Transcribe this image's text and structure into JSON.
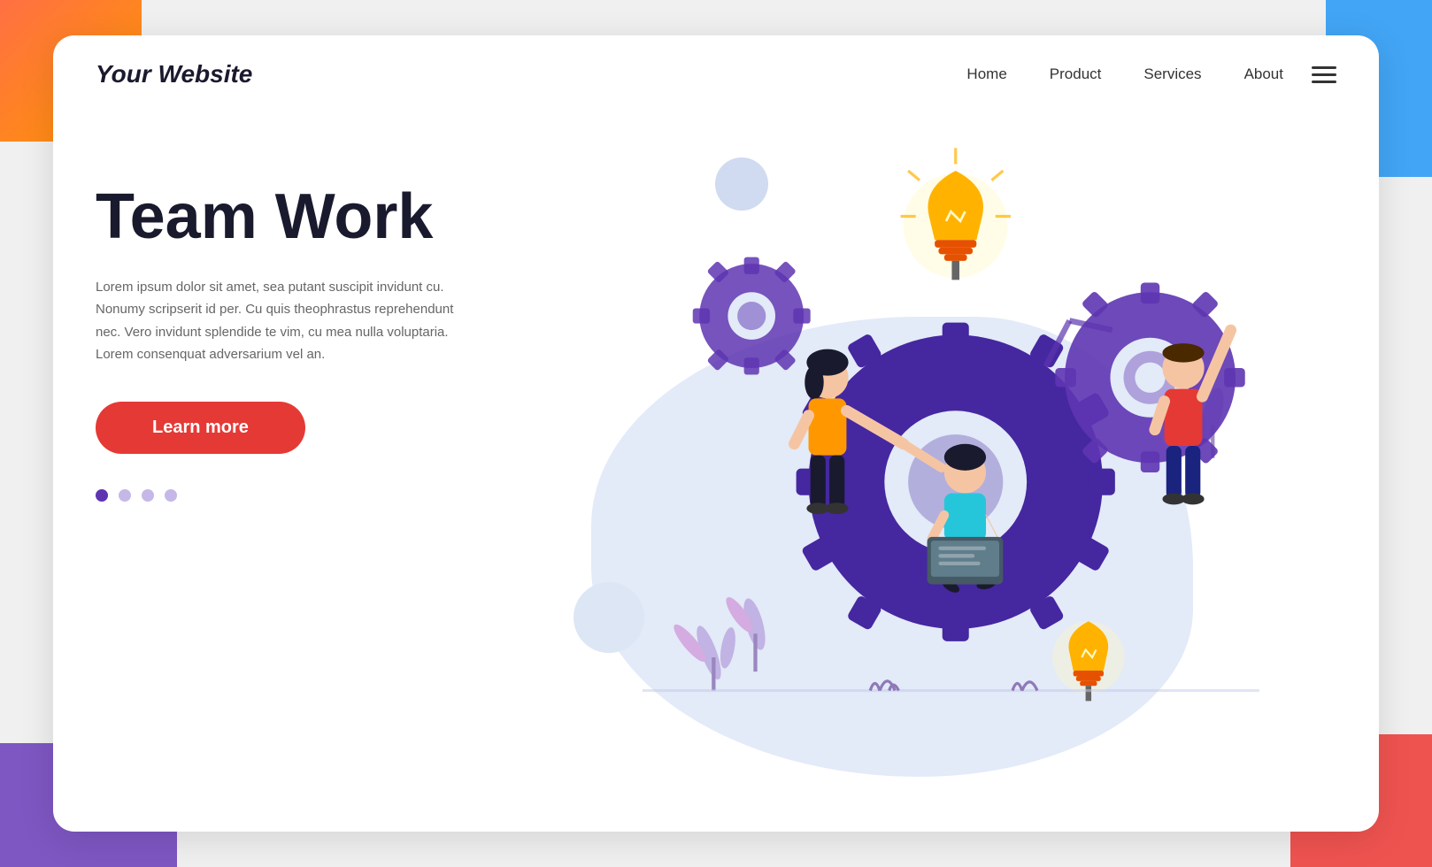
{
  "background": {
    "corners": {
      "tl": "orange-corner",
      "tr": "blue-corner",
      "bl": "purple-corner",
      "br": "red-corner"
    }
  },
  "navbar": {
    "brand": "Your Website",
    "links": [
      {
        "label": "Home",
        "id": "home"
      },
      {
        "label": "Product",
        "id": "product"
      },
      {
        "label": "Services",
        "id": "services"
      },
      {
        "label": "About",
        "id": "about"
      }
    ],
    "hamburger_label": "menu"
  },
  "hero": {
    "title": "Team Work",
    "description": "Lorem ipsum dolor sit amet, sea putant suscipit invidunt cu. Nonumy scripserit id per. Cu quis theophrastus reprehendunt nec. Vero invidunt splendide te vim, cu mea nulla voluptaria. Lorem consenquat adversarium vel an.",
    "cta_button": "Learn more",
    "dots": [
      {
        "active": true
      },
      {
        "active": false
      },
      {
        "active": false
      },
      {
        "active": false
      }
    ]
  },
  "colors": {
    "brand_dark": "#1a1a2e",
    "accent_purple": "#5e35b1",
    "gear_purple": "#4527a0",
    "cta_red": "#e53935",
    "lightbulb_orange": "#ffb300",
    "blob_bg": "#e3eaf8"
  }
}
